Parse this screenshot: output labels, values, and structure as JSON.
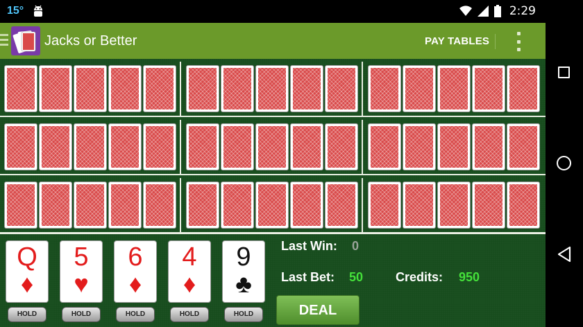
{
  "status_bar": {
    "temperature": "15°",
    "time": "2:29",
    "icons": [
      "android-debug-icon",
      "wifi-icon",
      "cell-signal-icon",
      "battery-icon"
    ]
  },
  "app_bar": {
    "title": "Jacks or Better",
    "pay_tables_label": "PAY TABLES",
    "icons": [
      "drawer-icon",
      "app-logo-icon",
      "overflow-menu-icon"
    ],
    "accent_color": "#6b9a2a"
  },
  "hands": {
    "rows": 3,
    "groups_per_row": 3,
    "cards_per_group": 5,
    "card_back_color": "#d94a4a"
  },
  "main_hand": {
    "cards": [
      {
        "rank": "Q",
        "suit": "♦",
        "color": "red"
      },
      {
        "rank": "5",
        "suit": "♥",
        "color": "red"
      },
      {
        "rank": "6",
        "suit": "♦",
        "color": "red"
      },
      {
        "rank": "4",
        "suit": "♦",
        "color": "red"
      },
      {
        "rank": "9",
        "suit": "♣",
        "color": "black"
      }
    ],
    "hold_label": "HOLD"
  },
  "info": {
    "last_win_label": "Last Win:",
    "last_win_value": "0",
    "last_bet_label": "Last Bet:",
    "last_bet_value": "50",
    "credits_label": "Credits:",
    "credits_value": "950"
  },
  "deal_button": {
    "label": "DEAL"
  },
  "nav_bar": {
    "icons": [
      "recents-icon",
      "home-icon",
      "back-icon"
    ]
  }
}
